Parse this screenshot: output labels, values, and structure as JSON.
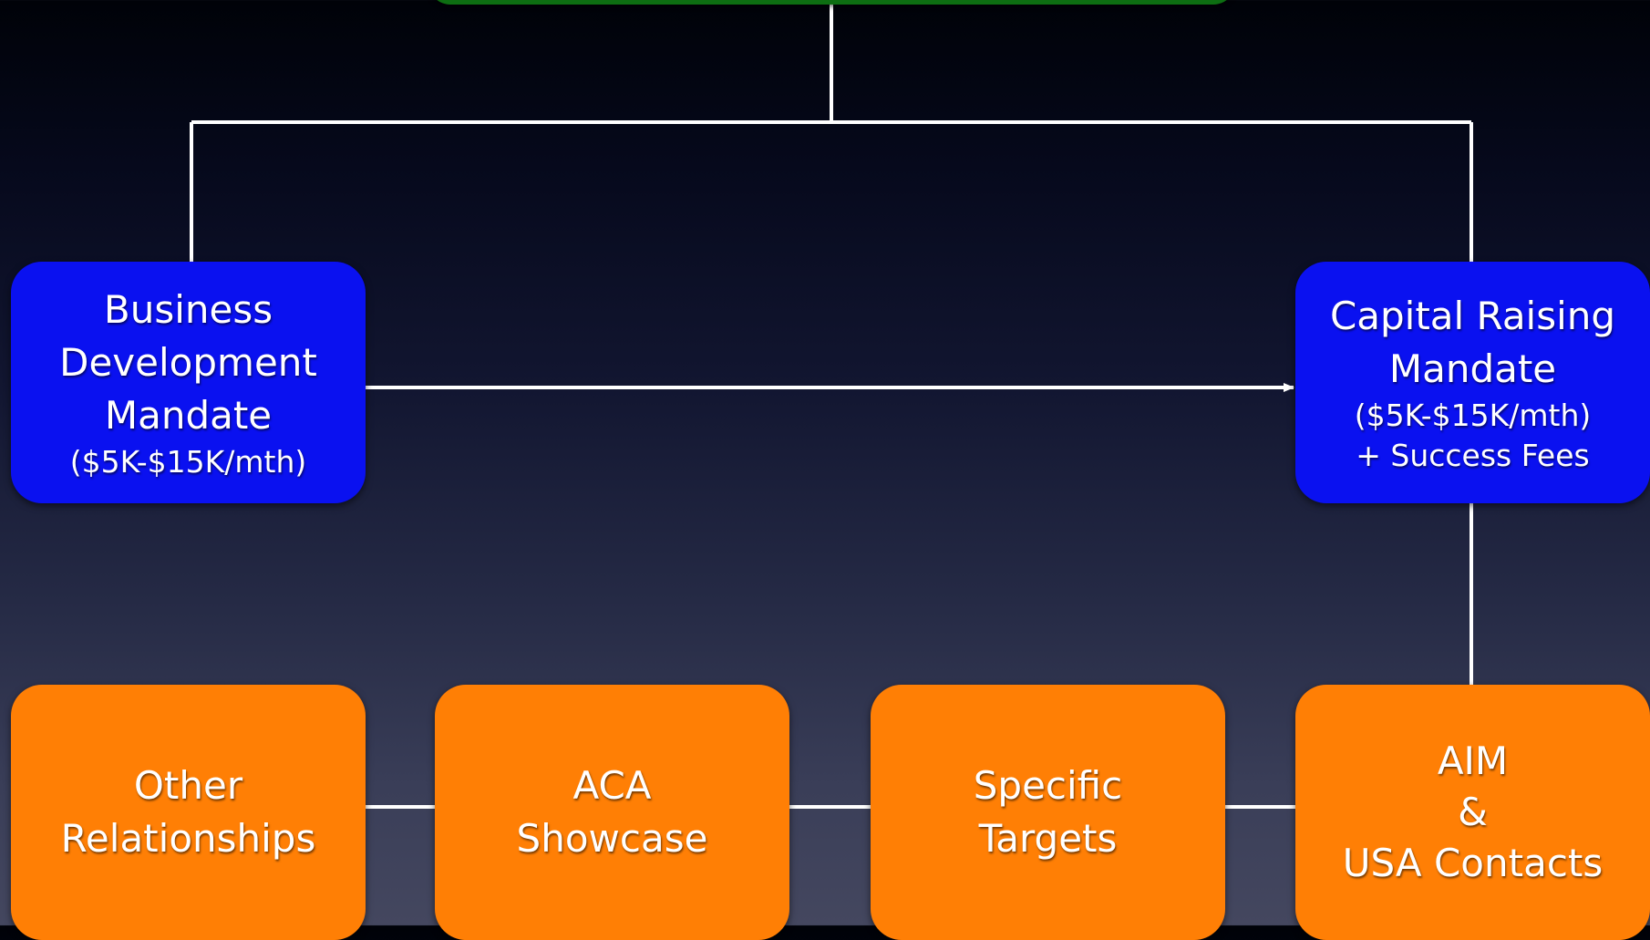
{
  "diagram": {
    "nodes": {
      "top": {
        "label": ""
      },
      "business_development": {
        "title": "Business\nDevelopment\nMandate",
        "detail": "($5K-$15K/mth)"
      },
      "capital_raising": {
        "title": "Capital Raising\nMandate",
        "detail": "($5K-$15K/mth)\n+ Success Fees"
      },
      "other_relationships": {
        "title": "Other\nRelationships"
      },
      "aca_showcase": {
        "title": "ACA\nShowcase"
      },
      "specific_targets": {
        "title": "Specific\nTargets"
      },
      "aim_usa": {
        "title": "AIM\n&\nUSA Contacts"
      }
    },
    "colors": {
      "top_node": "#0d6e12",
      "mandate_node": "#0a11f0",
      "channel_node": "#ff7f05",
      "connector": "#ffffff"
    },
    "edges": [
      {
        "from": "top",
        "to": "business_development"
      },
      {
        "from": "top",
        "to": "capital_raising"
      },
      {
        "from": "business_development",
        "to": "capital_raising",
        "arrow": true
      },
      {
        "from": "capital_raising",
        "to": "aim_usa"
      },
      {
        "from": "other_relationships",
        "to": "aca_showcase"
      },
      {
        "from": "aca_showcase",
        "to": "specific_targets"
      },
      {
        "from": "specific_targets",
        "to": "aim_usa"
      }
    ]
  }
}
